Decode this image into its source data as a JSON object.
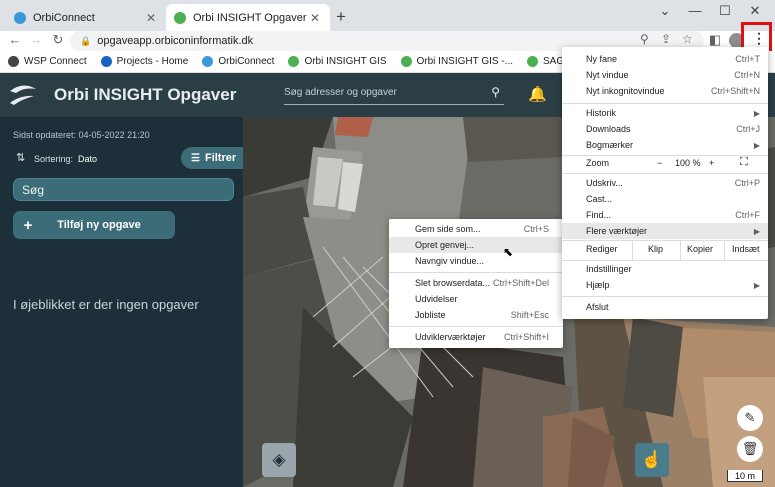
{
  "browser": {
    "tabs": [
      {
        "title": "OrbiConnect",
        "active": false,
        "favicon_color": "#3a9ad9"
      },
      {
        "title": "Orbi INSIGHT Opgaver",
        "active": true,
        "favicon_color": "#4caf50"
      }
    ],
    "url": "opgaveapp.orbiconinformatik.dk",
    "bookmarks": [
      {
        "label": "WSP Connect",
        "color": "#444"
      },
      {
        "label": "Projects - Home",
        "color": "#1565c0"
      },
      {
        "label": "OrbiConnect",
        "color": "#3a9ad9"
      },
      {
        "label": "Orbi INSIGHT GIS",
        "color": "#4caf50"
      },
      {
        "label": "Orbi INSIGHT GIS -...",
        "color": "#4caf50"
      },
      {
        "label": "SAGA-WspCustome...",
        "color": "#4caf50"
      }
    ]
  },
  "app": {
    "title": "Orbi INSIGHT Opgaver",
    "search_placeholder": "Søg adresser og opgaver",
    "last_updated": "Sidst opdateret: 04-05-2022 21:20",
    "sort_label": "Sortering:",
    "sort_value": "Dato",
    "filter_label": "Filtrer",
    "task_search": "Søg",
    "add_task": "Tilføj ny opgave",
    "empty_message": "I øjeblikket er der ingen opgaver",
    "scale_label": "10 m"
  },
  "menu": {
    "new_tab": {
      "label": "Ny fane",
      "shortcut": "Ctrl+T"
    },
    "new_window": {
      "label": "Nyt vindue",
      "shortcut": "Ctrl+N"
    },
    "incognito": {
      "label": "Nyt inkognitovindue",
      "shortcut": "Ctrl+Shift+N"
    },
    "history": {
      "label": "Historik"
    },
    "downloads": {
      "label": "Downloads",
      "shortcut": "Ctrl+J"
    },
    "bookmarks": {
      "label": "Bogmærker"
    },
    "zoom": {
      "label": "Zoom",
      "minus": "−",
      "value": "100 %",
      "plus": "+"
    },
    "print": {
      "label": "Udskriv...",
      "shortcut": "Ctrl+P"
    },
    "cast": {
      "label": "Cast..."
    },
    "find": {
      "label": "Find...",
      "shortcut": "Ctrl+F"
    },
    "more_tools": {
      "label": "Flere værktøjer"
    },
    "edit": {
      "label": "Rediger",
      "cut": "Klip",
      "copy": "Kopier",
      "paste": "Indsæt"
    },
    "settings": {
      "label": "Indstillinger"
    },
    "help": {
      "label": "Hjælp"
    },
    "exit": {
      "label": "Afslut"
    }
  },
  "submenu": {
    "save_page": {
      "label": "Gem side som...",
      "shortcut": "Ctrl+S"
    },
    "create_shortcut": {
      "label": "Opret genvej..."
    },
    "name_window": {
      "label": "Navngiv vindue..."
    },
    "clear_data": {
      "label": "Slet browserdata...",
      "shortcut": "Ctrl+Shift+Del"
    },
    "extensions": {
      "label": "Udvidelser"
    },
    "task_manager": {
      "label": "Jobliste",
      "shortcut": "Shift+Esc"
    },
    "dev_tools": {
      "label": "Udviklerværktøjer",
      "shortcut": "Ctrl+Shift+I"
    }
  },
  "colors": {
    "header": "#2c3e45",
    "sidebar": "#1d3039",
    "accent": "#3d6c79",
    "highlight_box": "#e01010"
  }
}
